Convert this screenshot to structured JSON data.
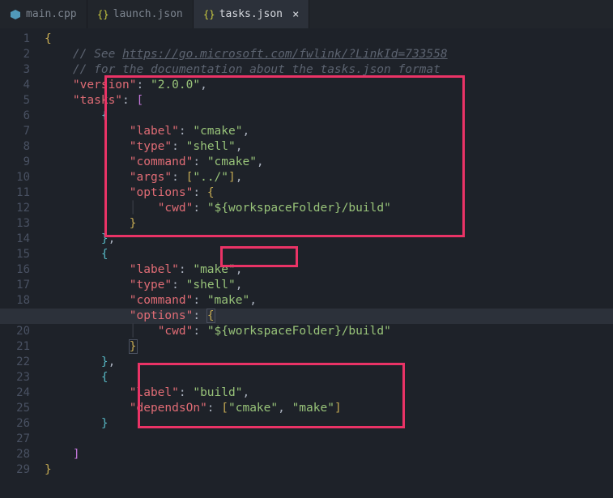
{
  "tabs": [
    {
      "label": "main.cpp",
      "icon": "cpp"
    },
    {
      "label": "launch.json",
      "icon": "json"
    },
    {
      "label": "tasks.json",
      "icon": "json",
      "active": true,
      "close": "×"
    }
  ],
  "lineCount": 29,
  "code": {
    "l2_comment_pre": "// See ",
    "l2_link": "https://go.microsoft.com/fwlink/?LinkId=733558",
    "l3_comment": "// for the documentation about the tasks.json format",
    "version_key": "\"version\"",
    "version_val": "\"2.0.0\"",
    "tasks_key": "\"tasks\"",
    "label_key": "\"label\"",
    "type_key": "\"type\"",
    "command_key": "\"command\"",
    "args_key": "\"args\"",
    "options_key": "\"options\"",
    "cwd_key": "\"cwd\"",
    "dependsOn_key": "\"dependsOn\"",
    "val_cmake": "\"cmake\"",
    "val_shell": "\"shell\"",
    "val_make": "\"make\"",
    "val_build": "\"build\"",
    "val_dotdot": "\"../\"",
    "val_cwd": "\"${workspaceFolder}/build\""
  }
}
